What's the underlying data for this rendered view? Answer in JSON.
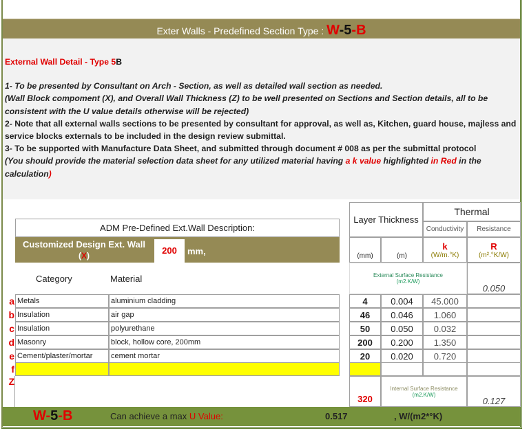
{
  "header": {
    "title": "Exter Walls - Predefined Section  Type :",
    "code": {
      "w": "W",
      "dash1": "-",
      "n": "5",
      "dash2": "-",
      "b": "B"
    }
  },
  "notes": {
    "subtitle": "External Wall Detail - Type 5",
    "subtitle_suffix": "B",
    "line1": "1- To be presented by Consultant on Arch - Section, as well as detailed wall section as needed.",
    "line1b": "(Wall Block compoment (X), and Overall Wall Thickness (Z) to be well presented on Sections and Section details, all to be consistent with the U value details otherwise will be rejected)",
    "line2": "2- Note that all external walls sections to be presented by consultant for approval, as well as, Kitchen, guard house, majless and service blocks externals to be included in the design review submittal.",
    "line3": "3- To be supported with Manufacture Data Sheet, and submitted through document # 008 as per the submittal protocol",
    "line3b_a": "(You should provide the material selection data sheet for any utilized material having ",
    "line3b_k": "a k value",
    "line3b_b": "  highlighted ",
    "line3b_red": "in Red",
    "line3b_c": "  in the calculation",
    "line3b_end": ")"
  },
  "table": {
    "adm_title": "ADM Pre-Defined Ext.Wall Description:",
    "custom_label": "Customized Design Ext. Wall",
    "custom_x_open": "(",
    "custom_x": "X",
    "custom_x_close": ")",
    "custom_value": "200",
    "custom_unit": "mm,",
    "layer_thickness": "Layer Thickness",
    "thermal": "Thermal",
    "conductivity": "Conductivity",
    "resistance": "Resistance",
    "unit_mm": "(mm)",
    "unit_m": "(m)",
    "k": "k",
    "k_unit": "(W/m.°K)",
    "r": "R",
    "r_unit": "(m².°K/W)",
    "category": "Category",
    "material": "Material",
    "ext_surface": "External Surface Resistance",
    "ext_surface_unit": "(m2.K/W)",
    "ext_value": "0.050",
    "rows": [
      {
        "letter": "a",
        "category": "Metals",
        "material": "aluminium cladding",
        "mm": "4",
        "m": "0.004",
        "k": "45.000"
      },
      {
        "letter": "b",
        "category": "Insulation",
        "material": "air gap",
        "mm": "46",
        "m": "0.046",
        "k": "1.060"
      },
      {
        "letter": "c",
        "category": "Insulation",
        "material": "polyurethane",
        "mm": "50",
        "m": "0.050",
        "k": "0.032"
      },
      {
        "letter": "d",
        "category": "Masonry",
        "material": "block, hollow core, 200mm",
        "mm": "200",
        "m": "0.200",
        "k": "1.350"
      },
      {
        "letter": "e",
        "category": "Cement/plaster/mortar",
        "material": "cement mortar",
        "mm": "20",
        "m": "0.020",
        "k": "0.720"
      }
    ],
    "row_f_letter": "f",
    "row_z_letter": "Z",
    "total_mm": "320",
    "int_surface": "Internal Surface Resistance",
    "int_surface_unit": "(m2.K/W)",
    "int_value": "0.127"
  },
  "footer": {
    "code": {
      "w": "W",
      "dash1": "-",
      "n": "5",
      "dash2": "-",
      "b": "B"
    },
    "label": "Can achieve a max ",
    "label_red": "U Value:",
    "value": "0.517",
    "unit": ", W/(m2*°K)"
  }
}
